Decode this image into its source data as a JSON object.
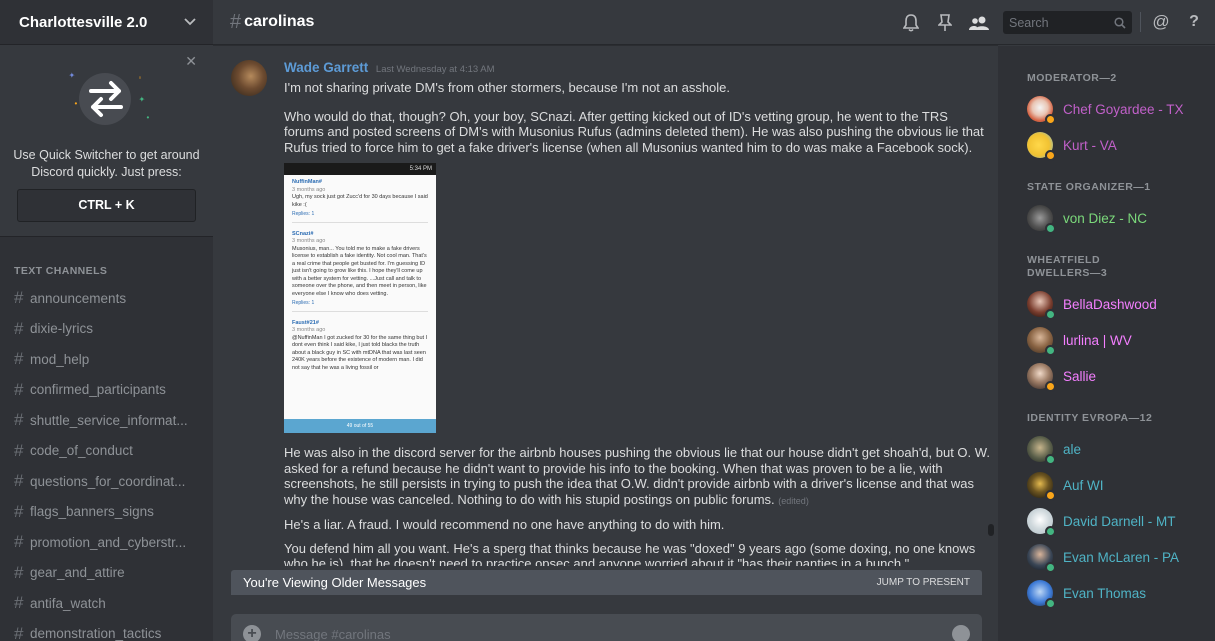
{
  "guild": {
    "name": "Charlottesville 2.0"
  },
  "quick_switcher": {
    "description": "Use Quick Switcher to get around Discord quickly. Just press:",
    "shortcut": "CTRL + K"
  },
  "sidebar": {
    "section_label": "TEXT CHANNELS",
    "channels": [
      "announcements",
      "dixie-lyrics",
      "mod_help",
      "confirmed_participants",
      "shuttle_service_informat...",
      "code_of_conduct",
      "questions_for_coordinat...",
      "flags_banners_signs",
      "promotion_and_cyberstr...",
      "gear_and_attire",
      "antifa_watch",
      "demonstration_tactics"
    ]
  },
  "channel": {
    "hash": "#",
    "name": "carolinas"
  },
  "toolbar": {
    "search_placeholder": "Search",
    "mention_symbol": "@",
    "help_symbol": "?"
  },
  "message": {
    "author": "Wade Garrett",
    "timestamp": "Last Wednesday at 4:13 AM",
    "lines": [
      "I'm not sharing private DM's from other stormers, because I'm not an asshole.",
      "Who would do that, though? Oh, your boy, SCnazi. After getting kicked out of ID's vetting group, he went to the TRS forums and posted screens of DM's with Musonius Rufus (admins deleted them). He was also pushing the obvious lie that Rufus tried to force him to get a fake driver's license (when all Musonius wanted him to do was make a Facebook sock).",
      "He was also in the discord server for the airbnb houses pushing the obvious lie that our house didn't get shoah'd, but O. W. asked for a refund because he didn't want to provide his info to the booking. When that was proven to be a lie, with screenshots, he still persists in trying to push the idea that O.W. didn't provide airbnb with a driver's license and that was why the house was canceled. Nothing to do with his stupid postings on public forums.",
      "He's a liar. A fraud. I would recommend no one have anything to do with him.",
      "You defend him all you want. He's a sperg that thinks because he was \"doxed\" 9 years ago (some doxing, no one knows who he is), that he doesn't need to practice opsec and anyone worried about it \"has their panties in a bunch.\""
    ],
    "edited_tag": "(edited)"
  },
  "attachment": {
    "status_time": "5:34 PM",
    "posts": [
      {
        "user": "NuffinMan#",
        "meta": "3 months ago",
        "text": "Ugh, my sock just got Zucc'd for 30 days because I said kike :(",
        "replies": "Replies: 1"
      },
      {
        "user": "SCnazi#",
        "meta": "3 months ago",
        "text": "Musonius, man... You told me to make a fake drivers license to establish a fake identity. Not cool man. That's a real crime that people get busted for. I'm guessing ID just isn't going to grow like this. I hope they'll come up with a better system for vetting. ...Just call and talk to someone over the phone, and then meet in person, like everyone else I know who does vetting.",
        "replies": "Replies: 1"
      },
      {
        "user": "Faust#21#",
        "meta": "3 months ago",
        "text": "@NuffinMan I got zucked for 30 for the same thing but I dont even think I said kike, I just told blacks the truth about a black guy in SC with mtDNA that was last seen 240K years before the existence of modern man. I did not say that he was a living fossil or",
        "replies": ""
      }
    ],
    "footer": "49 out of 55"
  },
  "older_bar": {
    "label": "You're Viewing Older Messages",
    "action": "JUMP TO PRESENT"
  },
  "composer": {
    "placeholder": "Message #carolinas"
  },
  "members": {
    "groups": [
      {
        "label": "MODERATOR—2",
        "members": [
          {
            "name": "Chef Goyardee - TX",
            "color": "#c160c9",
            "status": "#faa61a"
          },
          {
            "name": "Kurt - VA",
            "color": "#c160c9",
            "status": "#faa61a"
          }
        ]
      },
      {
        "label": "STATE ORGANIZER—1",
        "members": [
          {
            "name": "von Diez - NC",
            "color": "#7bd97b",
            "status": "#43b581"
          }
        ]
      },
      {
        "label": "WHEATFIELD DWELLERS—3",
        "members": [
          {
            "name": "BellaDashwood",
            "color": "#f47fff",
            "status": "#43b581"
          },
          {
            "name": "lurlina | WV",
            "color": "#f47fff",
            "status": "#43b581"
          },
          {
            "name": "Sallie",
            "color": "#f47fff",
            "status": "#faa61a"
          }
        ]
      },
      {
        "label": "IDENTITY EVROPA—12",
        "members": [
          {
            "name": "ale",
            "color": "#4fb3c5",
            "status": "#43b581"
          },
          {
            "name": "Auf WI",
            "color": "#4fb3c5",
            "status": "#faa61a"
          },
          {
            "name": "David Darnell - MT",
            "color": "#4fb3c5",
            "status": "#43b581"
          },
          {
            "name": "Evan McLaren - PA",
            "color": "#4fb3c5",
            "status": "#43b581"
          },
          {
            "name": "Evan Thomas",
            "color": "#4fb3c5",
            "status": "#43b581"
          }
        ]
      }
    ]
  }
}
